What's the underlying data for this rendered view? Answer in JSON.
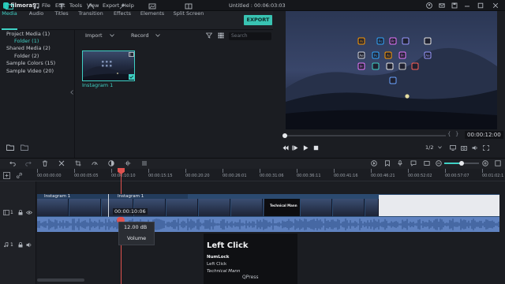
{
  "app": {
    "logo": "filmora9",
    "title": "Untitled : 00:06:03:03",
    "menu": [
      "File",
      "Edit",
      "Tools",
      "View",
      "Export",
      "Help"
    ]
  },
  "library_tabs": [
    {
      "label": "Media",
      "icon": "folder-icon",
      "active": true
    },
    {
      "label": "Audio",
      "icon": "music-note-icon",
      "active": false
    },
    {
      "label": "Titles",
      "icon": "text-t-icon",
      "active": false
    },
    {
      "label": "Transition",
      "icon": "transition-icon",
      "active": false
    },
    {
      "label": "Effects",
      "icon": "effects-icon",
      "active": false
    },
    {
      "label": "Elements",
      "icon": "elements-icon",
      "active": false
    },
    {
      "label": "Split Screen",
      "icon": "split-screen-icon",
      "active": false
    }
  ],
  "export_label": "EXPORT",
  "sidebar": {
    "items": [
      {
        "label": "Project Media (1)"
      },
      {
        "label": "Folder (1)",
        "selected": true
      },
      {
        "label": "Shared Media (2)"
      },
      {
        "label": "Folder (2)"
      },
      {
        "label": "Sample Colors (15)"
      },
      {
        "label": "Sample Video (20)"
      }
    ]
  },
  "media_bar": {
    "import": "Import",
    "record": "Record",
    "search_placeholder": "Search"
  },
  "media_item": {
    "label": "Instagram 1"
  },
  "preview": {
    "timecode": "00:00:12:00",
    "ratio": "1/2",
    "progress_fraction": 0.02,
    "desktop_icons": [
      "Ai",
      "Ps",
      "Pr",
      "",
      "",
      "Ae",
      "Ps",
      "Ai",
      "Pr",
      "Ae",
      "Pr",
      "",
      "",
      "",
      "",
      ""
    ]
  },
  "timeline": {
    "ruler_ticks": [
      "00:00:00:00",
      "00:00:05:05",
      "00:00:10:10",
      "00:00:15:15",
      "00:00:20:20",
      "00:00:26:01",
      "00:00:31:06",
      "00:00:36:11",
      "00:00:41:16",
      "00:00:46:21",
      "00:00:52:02",
      "00:00:57:07",
      "00:01:02:1"
    ],
    "video_clips": [
      "Instagram 1",
      "Instagram 1"
    ],
    "track_labels": [
      "1",
      "1"
    ],
    "tooltip_timecode": "00:00:10:06",
    "volume_db": "12.00 dB",
    "volume_label": "Volume"
  },
  "overlay": {
    "title": "Left Click",
    "key": "NumLock",
    "action": "Left Click",
    "credit": "Technical Mann",
    "brand": "QPress"
  },
  "colors": {
    "accent": "#3fd0c4",
    "playhead": "#e0524f",
    "audio": "#5f82c0",
    "video": "#2b4a70"
  }
}
